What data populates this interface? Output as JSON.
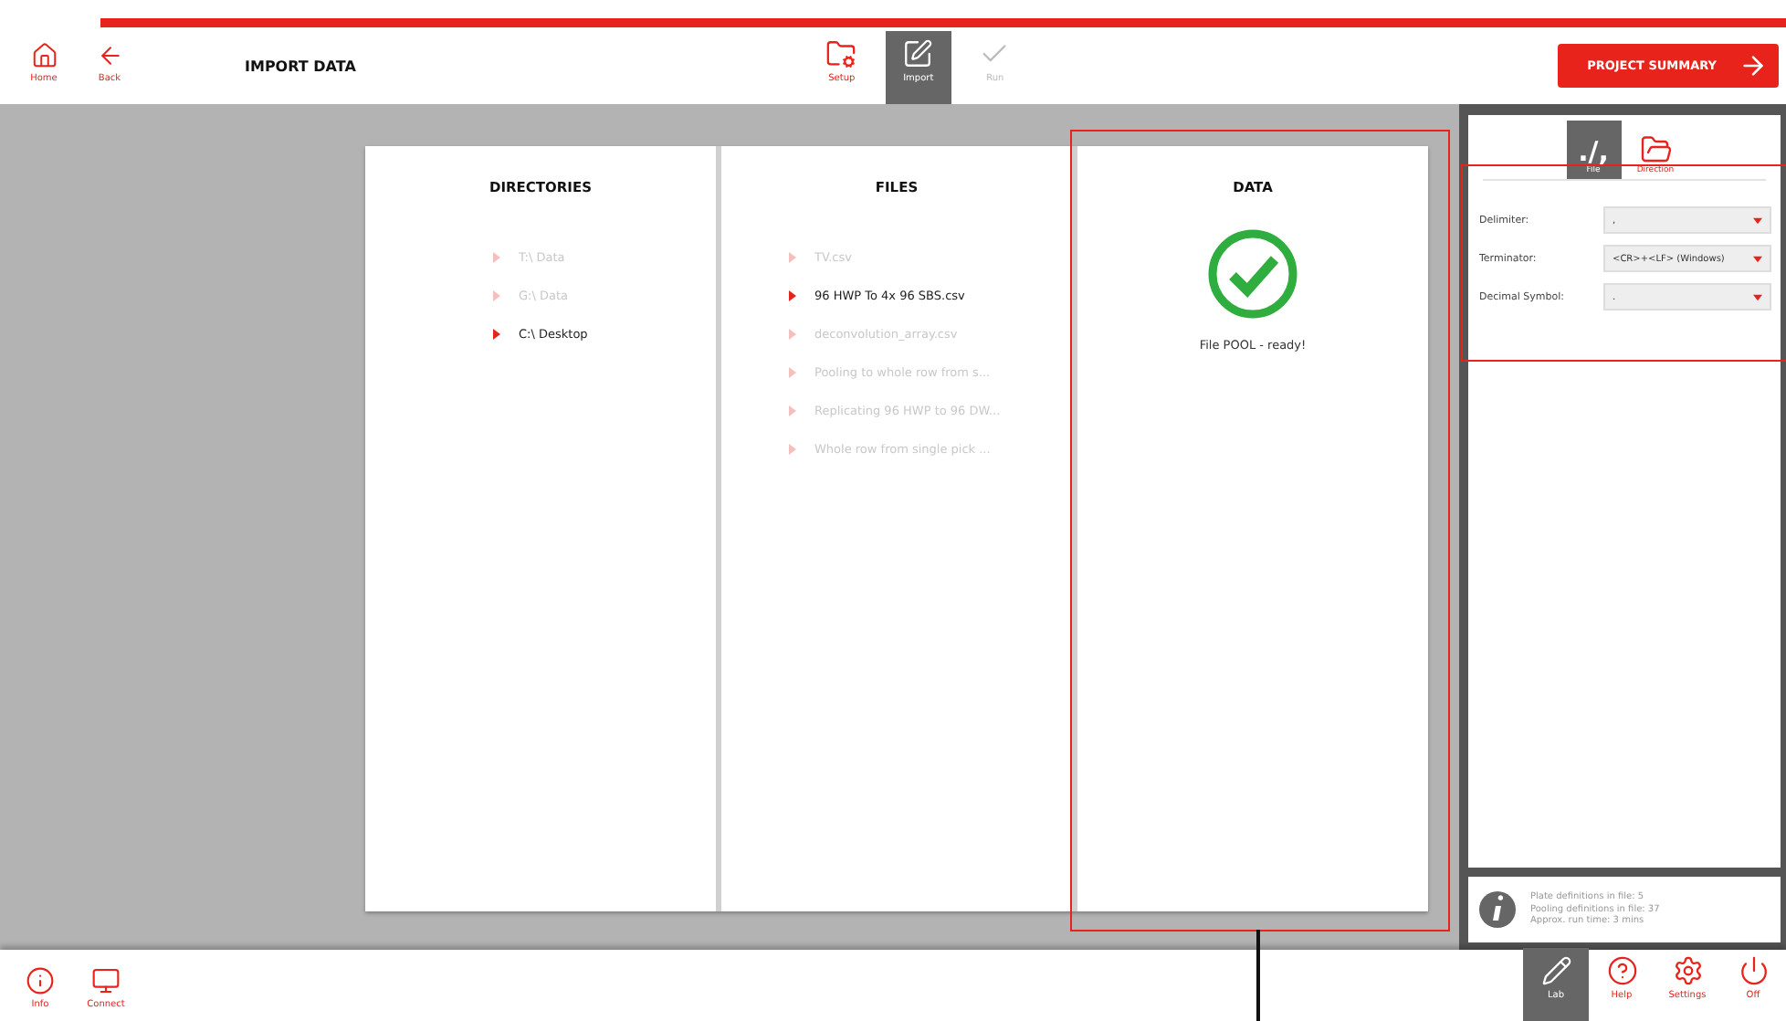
{
  "header": {
    "nav": [
      {
        "label": "Home",
        "kind": "home"
      },
      {
        "label": "Back",
        "kind": "back"
      }
    ],
    "title": "IMPORT DATA",
    "steps": [
      {
        "label": "Setup",
        "kind": "setup",
        "selected": false,
        "disabled": false
      },
      {
        "label": "Import",
        "kind": "import",
        "selected": true,
        "disabled": false
      },
      {
        "label": "Run",
        "kind": "run",
        "selected": false,
        "disabled": true
      }
    ],
    "summary_button": "PROJECT SUMMARY"
  },
  "directories": {
    "title": "DIRECTORIES",
    "items": [
      {
        "label": "T:\\ Data",
        "selected": false
      },
      {
        "label": "G:\\ Data",
        "selected": false
      },
      {
        "label": "C:\\ Desktop",
        "selected": true
      }
    ]
  },
  "files": {
    "title": "FILES",
    "items": [
      {
        "label": "TV.csv",
        "selected": false
      },
      {
        "label": "96 HWP To 4x 96 SBS.csv",
        "selected": true
      },
      {
        "label": "deconvolution_array.csv",
        "selected": false
      },
      {
        "label": "Pooling to whole row from s...",
        "selected": false
      },
      {
        "label": "Replicating 96 HWP to 96 DW...",
        "selected": false
      },
      {
        "label": "Whole row from single pick ...",
        "selected": false
      }
    ]
  },
  "data": {
    "title": "DATA",
    "status": "File POOL - ready!"
  },
  "sidebar": {
    "tabs": [
      {
        "label": "File",
        "glyph": "./,",
        "kind": "file",
        "selected": true
      },
      {
        "label": "Direction",
        "kind": "folder",
        "selected": false
      }
    ],
    "fields": [
      {
        "label": "Delimiter:",
        "value": ","
      },
      {
        "label": "Terminator:",
        "value": "<CR>+<LF> (Windows)"
      },
      {
        "label": "Decimal Symbol:",
        "value": "."
      }
    ],
    "info": [
      "Plate definitions in file: 5",
      "Pooling definitions in file: 37",
      "Approx. run time: 3 mins"
    ]
  },
  "footer": {
    "left": [
      {
        "label": "Info",
        "kind": "info"
      },
      {
        "label": "Connect",
        "kind": "connect"
      }
    ],
    "right": [
      {
        "label": "Lab",
        "kind": "lab",
        "selected": true
      },
      {
        "label": "Help",
        "kind": "help",
        "selected": false
      },
      {
        "label": "Settings",
        "kind": "settings",
        "selected": false
      },
      {
        "label": "Off",
        "kind": "off",
        "selected": false
      }
    ]
  }
}
